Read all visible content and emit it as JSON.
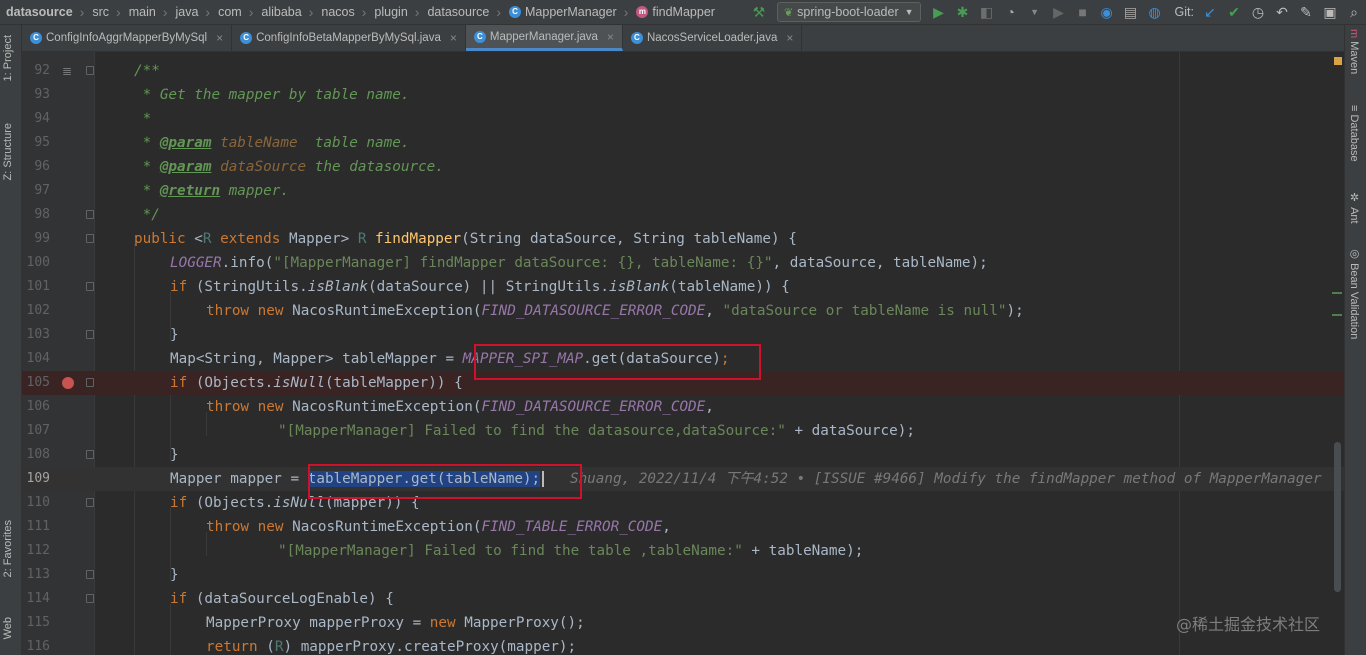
{
  "breadcrumbs": [
    "datasource",
    "src",
    "main",
    "java",
    "com",
    "alibaba",
    "nacos",
    "plugin",
    "datasource"
  ],
  "breadcrumb_class": "MapperManager",
  "breadcrumb_method": "findMapper",
  "run_config": "spring-boot-loader",
  "vcs_label": "Git:",
  "tabs": [
    {
      "label": "ConfigInfoAggrMapperByMySql",
      "active": false
    },
    {
      "label": "ConfigInfoBetaMapperByMySql.java",
      "active": false
    },
    {
      "label": "MapperManager.java",
      "active": true
    },
    {
      "label": "NacosServiceLoader.java",
      "active": false
    }
  ],
  "left_tools": [
    "1: Project",
    "Z: Structure",
    "2: Favorites",
    "Web"
  ],
  "right_tools": [
    "Maven",
    "Database",
    "Ant",
    "Bean Validation"
  ],
  "line_numbers": [
    "92",
    "93",
    "94",
    "95",
    "96",
    "97",
    "98",
    "99",
    "100",
    "101",
    "102",
    "103",
    "104",
    "105",
    "106",
    "107",
    "108",
    "109",
    "110",
    "111",
    "112",
    "113",
    "114",
    "115",
    "116"
  ],
  "code": {
    "l92": "/**",
    "l93": " * Get the mapper by table name.",
    "l94": " *",
    "l95_a": " * ",
    "l95_tag": "@param",
    "l95_p": " tableName",
    "l95_b": "  table name.",
    "l96_a": " * ",
    "l96_tag": "@param",
    "l96_p": " dataSource",
    "l96_b": " the datasource.",
    "l97_a": " * ",
    "l97_tag": "@return",
    "l97_b": " mapper.",
    "l98": " */",
    "l99_kw1": "public",
    "l99_a": " <",
    "l99_r": "R",
    "l99_kw2": " extends",
    "l99_b": " Mapper> ",
    "l99_r2": "R",
    "l99_sp": " ",
    "l99_fn": "findMapper",
    "l99_c": "(String dataSource, String tableName) {",
    "l100_fld": "LOGGER",
    "l100_a": ".info(",
    "l100_str": "\"[MapperManager] findMapper dataSource: {}, tableName: {}\"",
    "l100_b": ", dataSource, tableName);",
    "l101_kw": "if",
    "l101_a": " (StringUtils.",
    "l101_it1": "isBlank",
    "l101_b": "(dataSource) || StringUtils.",
    "l101_it2": "isBlank",
    "l101_c": "(tableName)) {",
    "l102_kw1": "throw",
    "l102_kw2": " new",
    "l102_a": " NacosRuntimeException(",
    "l102_fld": "FIND_DATASOURCE_ERROR_CODE",
    "l102_b": ", ",
    "l102_str": "\"dataSource or tableName is null\"",
    "l102_c": ");",
    "l103": "}",
    "l104_a": "Map<String, Mapper> tableMapper = ",
    "l104_fld": "MAPPER_SPI_MAP",
    "l104_b": ".get(dataSource)",
    "l104_c": ";",
    "l105_kw": "if",
    "l105_a": " (Objects.",
    "l105_it": "isNull",
    "l105_b": "(tableMapper)) {",
    "l106_kw1": "throw",
    "l106_kw2": " new",
    "l106_a": " NacosRuntimeException(",
    "l106_fld": "FIND_DATASOURCE_ERROR_CODE",
    "l106_b": ",",
    "l107_str": "\"[MapperManager] Failed to find the datasource,dataSource:\"",
    "l107_b": " + dataSource);",
    "l108": "}",
    "l109_a": "Mapper mapper = ",
    "l109_sel": "tableMapper.get(tableName);",
    "l109_blame": "Shuang, 2022/11/4 下午4:52 • [ISSUE #9466] Modify the findMapper method of MapperManager",
    "l110_kw": "if",
    "l110_a": " (Objects.",
    "l110_it": "isNull",
    "l110_b": "(mapper)) {",
    "l111_kw1": "throw",
    "l111_kw2": " new",
    "l111_a": " NacosRuntimeException(",
    "l111_fld": "FIND_TABLE_ERROR_CODE",
    "l111_b": ",",
    "l112_str": "\"[MapperManager] Failed to find the table ,tableName:\"",
    "l112_b": " + tableName);",
    "l113": "}",
    "l114_kw": "if",
    "l114_a": " (dataSourceLogEnable) {",
    "l115_a": "MapperProxy mapperProxy = ",
    "l115_kw": "new",
    "l115_b": " MapperProxy();",
    "l116_kw": "return",
    "l116_a": " (",
    "l116_r": "R",
    "l116_b": ") mapperProxy.createProxy(mapper);"
  },
  "watermark": "@稀土掘金技术社区",
  "colors": {
    "keyword": "#cc7832",
    "comment": "#629755",
    "string": "#6a8759",
    "field": "#9876aa",
    "method": "#ffc66d",
    "highlight_box": "#d0112b",
    "selection": "#214283"
  }
}
